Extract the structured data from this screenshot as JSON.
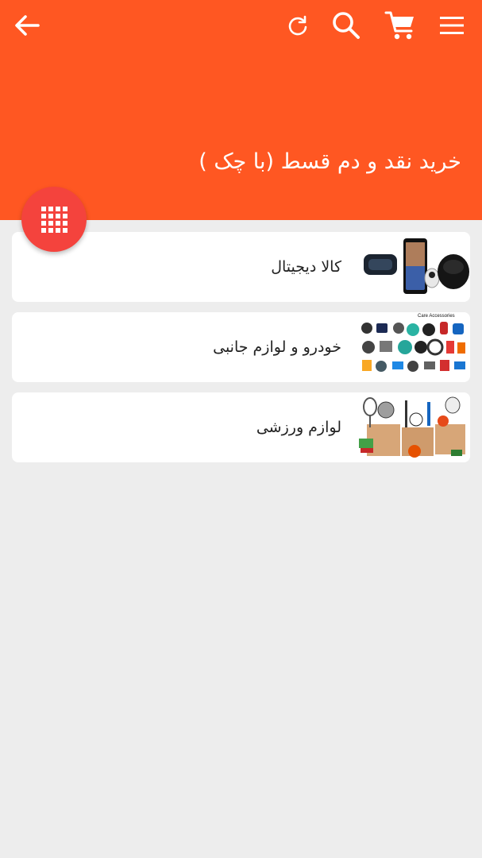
{
  "header": {
    "title": "خرید نقد و دم قسط (با چک )",
    "background": "#ff5722"
  },
  "icons": {
    "back": "arrow-left-icon",
    "refresh": "refresh-icon",
    "search": "search-icon",
    "cart": "cart-icon",
    "menu": "hamburger-menu-icon"
  },
  "fab": {
    "icon": "apps-grid-icon",
    "color": "#f4433d"
  },
  "categories": [
    {
      "label": "کالا دیجیتال",
      "image": "digital-goods-image"
    },
    {
      "label": "خودرو و لوازم جانبی",
      "image": "car-accessories-image",
      "image_caption": "Care Accessories"
    },
    {
      "label": "لوازم ورزشی",
      "image": "sports-equipment-image"
    }
  ]
}
